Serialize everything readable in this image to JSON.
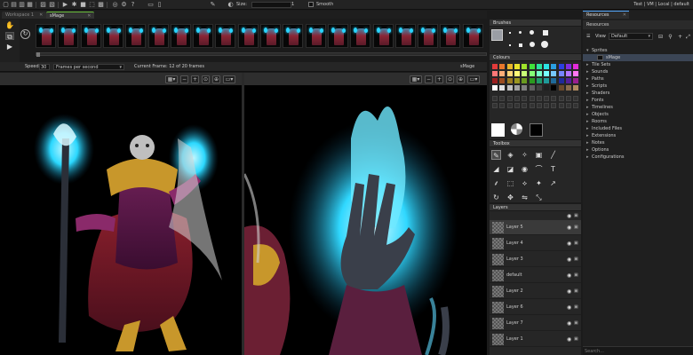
{
  "topbar": {
    "size_label": "Size:",
    "size_value": "1",
    "smooth_label": "Smooth",
    "right_info": "Test | VM | Local | default"
  },
  "tabs": [
    {
      "label": "Workspace 1",
      "active": false
    },
    {
      "label": "sMage",
      "active": true
    }
  ],
  "anim": {
    "speed_label": "Speed:",
    "speed_value": "30",
    "fps_mode": "Frames per second",
    "current_frame": "Current Frame: 12 of 20 frames",
    "sprite_name": "sMage",
    "frame_count": 20,
    "scrub_progress": 0.0
  },
  "brushes": {
    "title": "Brushes"
  },
  "colours": {
    "title": "Colours",
    "palette": [
      [
        "#e23b3b",
        "#e8772b",
        "#e8b62b",
        "#e8e22b",
        "#9fe22b",
        "#3fe23b",
        "#2be29f",
        "#2be2e2",
        "#2b9fe2",
        "#2b3fe2",
        "#7f2be2",
        "#e22bd9"
      ],
      [
        "#ff7777",
        "#ffae77",
        "#ffd577",
        "#fff977",
        "#c8ff77",
        "#85ff77",
        "#77ffc8",
        "#77ffff",
        "#77c8ff",
        "#7785ff",
        "#b577ff",
        "#ff77f2"
      ],
      [
        "#9a1f1f",
        "#9a4c1f",
        "#9a7a1f",
        "#9a961f",
        "#6a9a1f",
        "#2a9a1f",
        "#1f9a6a",
        "#1f9a9a",
        "#1f6a9a",
        "#1f2a9a",
        "#541f9a",
        "#9a1f90"
      ],
      [
        "#ffffff",
        "#e0e0e0",
        "#c0c0c0",
        "#a0a0a0",
        "#808080",
        "#606060",
        "#404040",
        "#202020",
        "#000000",
        "#6b4a2b",
        "#8b6b4b",
        "#b08b60"
      ]
    ],
    "primary": "#ffffff",
    "secondary": "#000000"
  },
  "toolbox": {
    "title": "Toolbox"
  },
  "layers": {
    "title": "Layers",
    "items": [
      "Layer 5",
      "Layer 4",
      "Layer 3",
      "default",
      "Layer 2",
      "Layer 6",
      "Layer 7",
      "Layer 1"
    ],
    "selected": "Layer 5"
  },
  "resources": {
    "tab_label": "Resources",
    "header": "Resources",
    "view_label": "View",
    "view_value": "Default",
    "tree": [
      "Sprites",
      "sMage",
      "Tile Sets",
      "Sounds",
      "Paths",
      "Scripts",
      "Shaders",
      "Fonts",
      "Timelines",
      "Objects",
      "Rooms",
      "Included Files",
      "Extensions",
      "Notes",
      "Options",
      "Configurations"
    ],
    "search_placeholder": "Search..."
  },
  "icons": {
    "new": "▫",
    "open": "▣",
    "save": "▤",
    "close": "✕"
  }
}
